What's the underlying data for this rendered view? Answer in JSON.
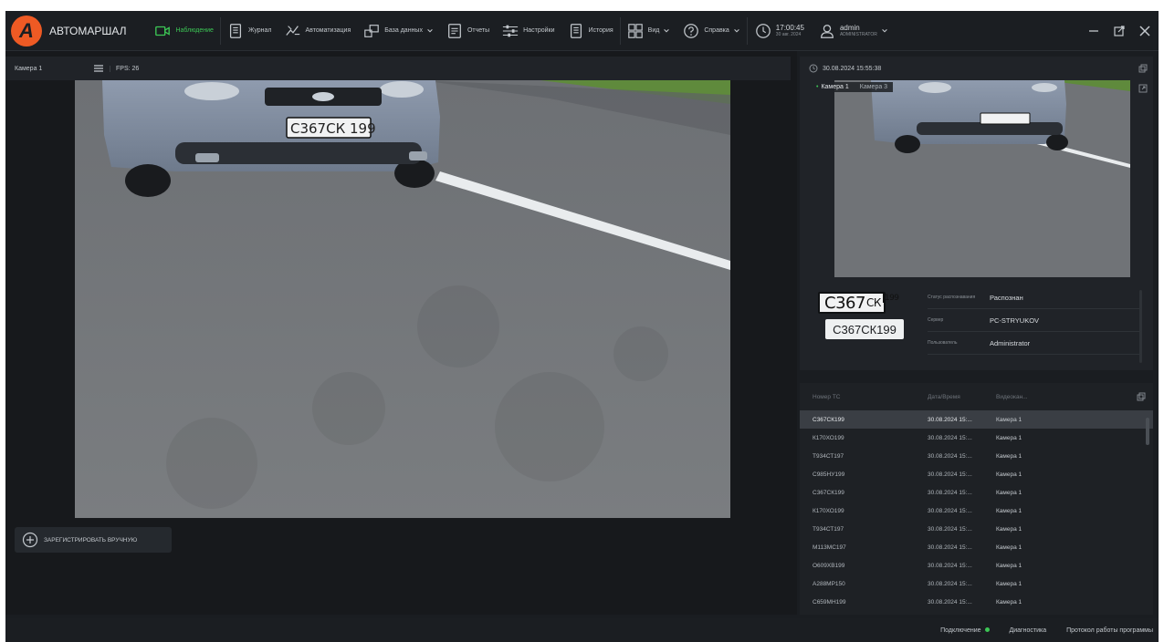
{
  "app": {
    "name": "АВТОМАРШАЛ"
  },
  "menu": {
    "items": [
      {
        "label": "Наблюдение",
        "icon": "camera-icon",
        "active": true
      },
      {
        "label": "Журнал",
        "icon": "journal-icon"
      },
      {
        "label": "Автоматизация",
        "icon": "automation-icon"
      },
      {
        "label": "База данных",
        "icon": "database-icon",
        "dropdown": true
      },
      {
        "label": "Отчеты",
        "icon": "report-icon"
      },
      {
        "label": "Настройки",
        "icon": "settings-sliders-icon"
      },
      {
        "label": "История",
        "icon": "history-icon"
      },
      {
        "label": "Вид",
        "icon": "grid-view-icon",
        "dropdown": true
      },
      {
        "label": "Справка",
        "icon": "help-icon",
        "dropdown": true
      }
    ],
    "clock": {
      "time": "17:00:45",
      "date": "30 авг. 2024"
    },
    "user": {
      "name": "admin",
      "role": "ADMINISTRATOR"
    }
  },
  "left": {
    "camera_name": "Камера 1",
    "fps": "FPS: 26",
    "register_label": "ЗАРЕГИСТРИРОВАТЬ ВРУЧНУЮ",
    "plate_on_car": "С367СК 199"
  },
  "snapshot": {
    "datetime": "30.08.2024 15:55:38",
    "tabs": [
      "Камера 1",
      "Камера 3"
    ],
    "plate_img": {
      "main": "С367",
      "letters": "СК",
      "region": "199"
    },
    "plate_text": "С367СК199",
    "info": [
      {
        "key": "Статус распознавания",
        "value": "Распознан"
      },
      {
        "key": "Сервер",
        "value": "PC-STRYUKOV"
      },
      {
        "key": "Пользователь",
        "value": "Administrator"
      }
    ]
  },
  "table": {
    "headers": [
      "Номер ТС",
      "Дата/Время",
      "Видеокан..."
    ],
    "rows": [
      [
        "С367СК199",
        "30.08.2024 15:...",
        "Камера 1"
      ],
      [
        "К170ХО199",
        "30.08.2024 15:...",
        "Камера 1"
      ],
      [
        "Т934СТ197",
        "30.08.2024 15:...",
        "Камера 1"
      ],
      [
        "С985НУ199",
        "30.08.2024 15:...",
        "Камера 1"
      ],
      [
        "С367СК199",
        "30.08.2024 15:...",
        "Камера 1"
      ],
      [
        "К170ХО199",
        "30.08.2024 15:...",
        "Камера 1"
      ],
      [
        "Т934СТ197",
        "30.08.2024 15:...",
        "Камера 1"
      ],
      [
        "М113МС197",
        "30.08.2024 15:...",
        "Камера 1"
      ],
      [
        "О609ХВ199",
        "30.08.2024 15:...",
        "Камера 1"
      ],
      [
        "А288МР150",
        "30.08.2024 15:...",
        "Камера 1"
      ],
      [
        "С659МН199",
        "30.08.2024 15:...",
        "Камера 1"
      ]
    ]
  },
  "status": {
    "connection": "Подключение",
    "diagnostics": "Диагностика",
    "protocol": "Протокол работы программы"
  },
  "colors": {
    "accent": "#3cc655",
    "logo": "#ee5a24",
    "background": "#1a1d21"
  }
}
